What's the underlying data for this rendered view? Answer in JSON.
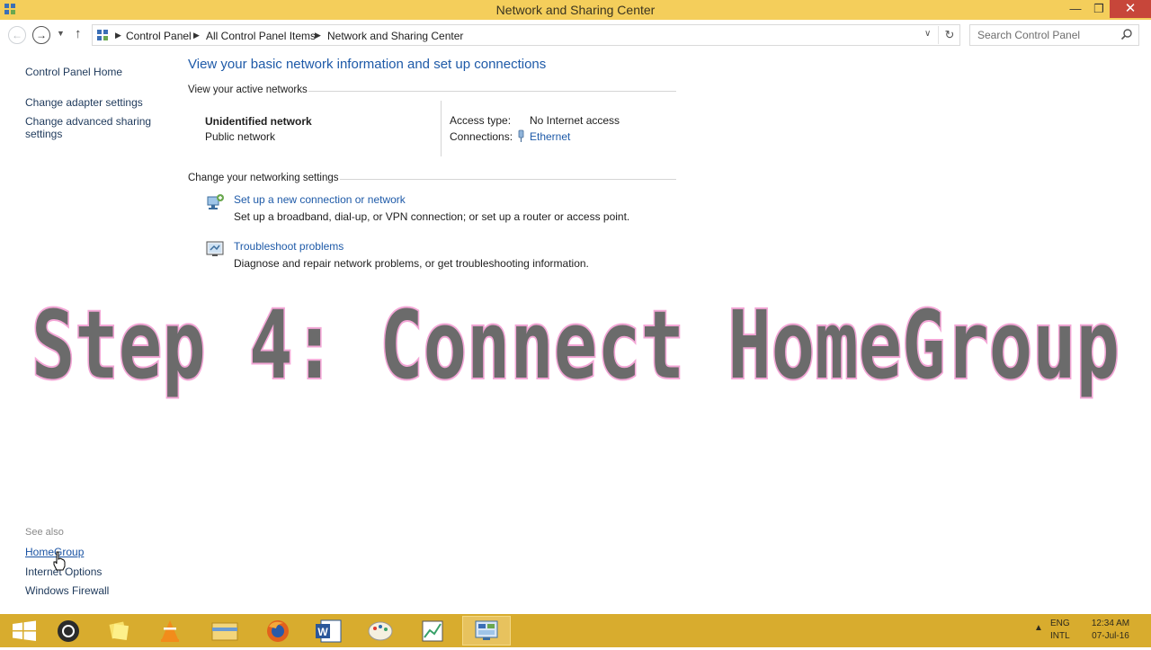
{
  "window": {
    "title": "Network and Sharing Center",
    "minimize_symbol": "—",
    "maximize_symbol": "❐",
    "close_symbol": "✕"
  },
  "address": {
    "crumbs": [
      "Control Panel",
      "All Control Panel Items",
      "Network and Sharing Center"
    ],
    "separator": "▶",
    "refresh_symbol": "↻",
    "dropdown_symbol": "∨"
  },
  "search": {
    "placeholder": "Search Control Panel"
  },
  "sidebar": {
    "home": "Control Panel Home",
    "adapter": "Change adapter settings",
    "advanced_line1": "Change advanced sharing",
    "advanced_line2": "settings",
    "see_also": "See also",
    "homegroup": "HomeGroup",
    "internet_options": "Internet Options",
    "firewall": "Windows Firewall"
  },
  "main": {
    "heading": "View your basic network information and set up connections",
    "active_networks_title": "View your active networks",
    "network_name": "Unidentified network",
    "network_type": "Public network",
    "access_type_label": "Access type:",
    "access_type_value": "No Internet access",
    "connections_label": "Connections:",
    "connections_value": "Ethernet",
    "settings_title": "Change your networking settings",
    "setup_link": "Set up a new connection or network",
    "setup_desc": "Set up a broadband, dial-up, or VPN connection; or set up a router or access point.",
    "troubleshoot_link": "Troubleshoot problems",
    "troubleshoot_desc": "Diagnose and repair network problems, or get troubleshooting information."
  },
  "overlay": {
    "text": "Step 4: Connect HomeGroup"
  },
  "tray": {
    "lang1": "ENG",
    "lang2": "INTL",
    "time": "12:34 AM",
    "date": "07-Jul-16"
  },
  "colors": {
    "titlebar": "#f4ce5b",
    "taskbar": "#d8ac2e",
    "link": "#1e5aa8",
    "overlay_fill": "#6b6b6b",
    "overlay_stroke": "#f3a6d6"
  }
}
